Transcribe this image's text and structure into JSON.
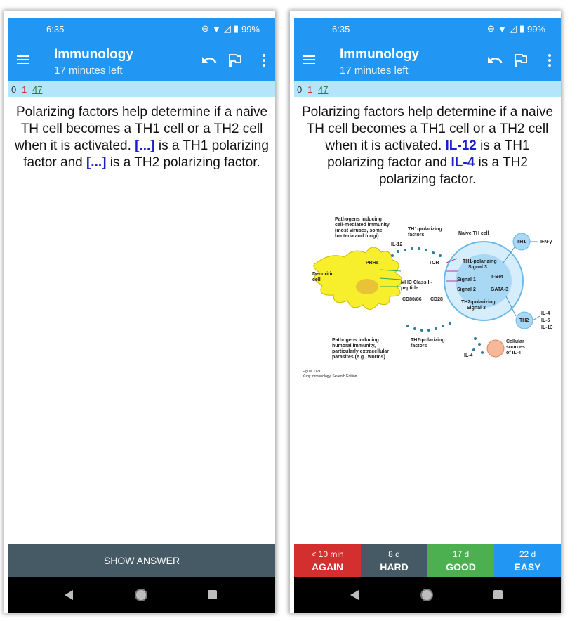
{
  "status": {
    "time": "6:35",
    "battery": "99%"
  },
  "toolbar": {
    "title": "Immunology",
    "subtitle": "17 minutes left"
  },
  "counts": {
    "new": "0",
    "learning": "1",
    "review": "47"
  },
  "question": {
    "part1": "Polarizing factors help determine if a naive TH cell becomes a TH1 cell or a TH2 cell when it is activated.",
    "cloze1": "[...]",
    "part2": "is a TH1 polarizing factor and",
    "cloze2": "[...]",
    "part3": "is a TH2 polarizing factor."
  },
  "answer": {
    "part1": "Polarizing factors help determine if a naive TH cell becomes a TH1 cell or a TH2 cell when it is activated.",
    "cloze1": "IL-12",
    "part2": "is a TH1 polarizing factor and",
    "cloze2": "IL-4",
    "part3": "is a TH2 polarizing factor."
  },
  "show_answer_label": "SHOW ANSWER",
  "buttons": [
    {
      "interval": "< 10 min",
      "label": "AGAIN",
      "color": "#d32f2f"
    },
    {
      "interval": "8 d",
      "label": "HARD",
      "color": "#455a64"
    },
    {
      "interval": "17 d",
      "label": "GOOD",
      "color": "#4caf50"
    },
    {
      "interval": "22 d",
      "label": "EASY",
      "color": "#2196f3"
    }
  ],
  "figure": {
    "pathogens_cell": [
      "Pathogens inducing",
      "cell-mediated immunity",
      "(most viruses, some",
      "bacteria and fungi)"
    ],
    "th1_factors": [
      "TH1-polarizing",
      "factors"
    ],
    "naive": "Naive TH cell",
    "il12": "IL-12",
    "prrs": "PRRs",
    "tcr": "TCR",
    "dendritic": [
      "Dendritic",
      "cell"
    ],
    "mhc": [
      "MHC Class II-",
      "peptide"
    ],
    "cd": "CD80/86",
    "cd28": "CD28",
    "th1_signal": [
      "TH1-polarizing",
      "Signal 3"
    ],
    "signal1": "Signal 1",
    "signal2": "Signal 2",
    "tbet": "T-Bet",
    "gata": "GATA-3",
    "th2_signal": [
      "TH2-polarizing",
      "Signal 3"
    ],
    "th1": "TH1",
    "th2": "TH2",
    "ifn": "IFN-γ",
    "il_list": [
      "IL-4",
      "IL-5",
      "IL-13"
    ],
    "pathogens_humoral": [
      "Pathogens inducing",
      "humoral immunity,",
      "particularly extracellular",
      "parasites (e.g., worms)"
    ],
    "th2_factors": [
      "TH2-polarizing",
      "factors"
    ],
    "il4": "IL-4",
    "cellular": [
      "Cellular",
      "sources",
      "of IL-4"
    ],
    "caption1": "Figure 11-9",
    "caption2": "Kuby Immunology, Seventh Edition"
  }
}
